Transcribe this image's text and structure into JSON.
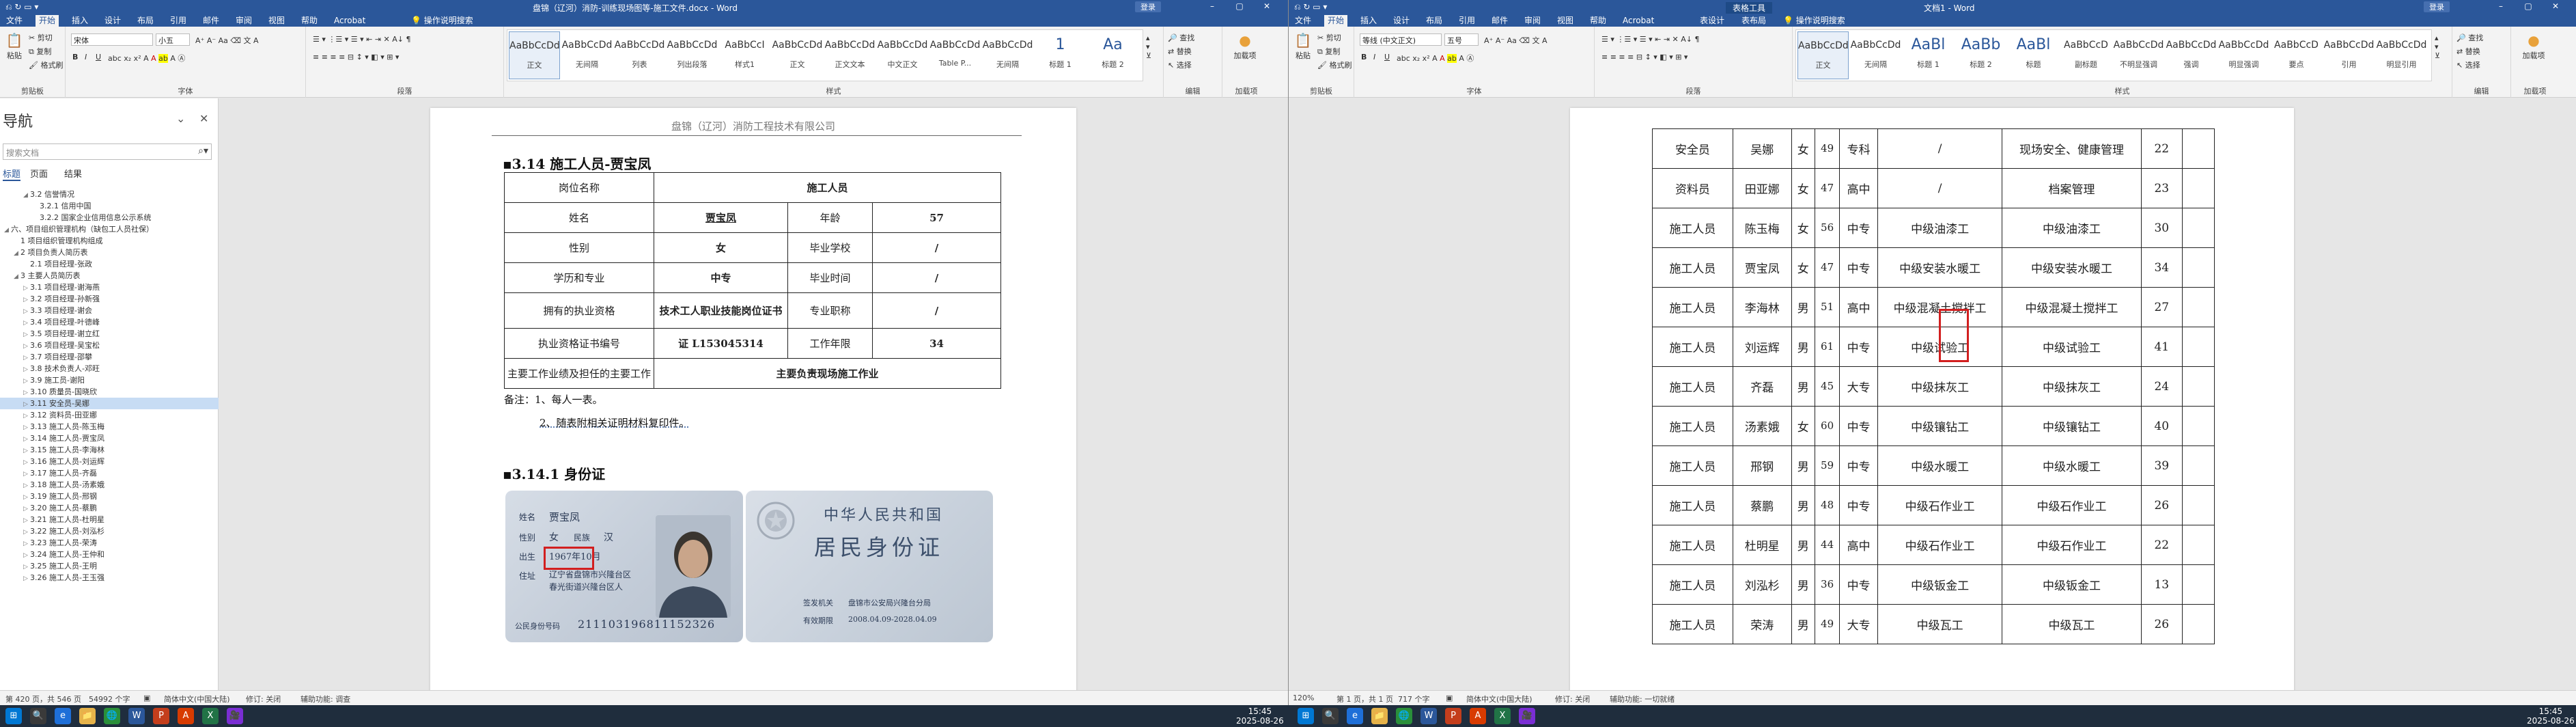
{
  "left": {
    "title": "盘锦（辽河）消防-训练现场图等-施工文件.docx - Word",
    "qat": "⎌ ↻ ▭ ▾",
    "share": "共享",
    "tabs": [
      "文件",
      "开始",
      "插入",
      "设计",
      "布局",
      "引用",
      "邮件",
      "审阅",
      "视图",
      "帮助",
      "Acrobat",
      "操作说明搜索"
    ],
    "ribbon": {
      "clipboard": {
        "label": "剪贴板",
        "paste": "粘贴",
        "cut": "剪切",
        "copy": "复制",
        "painter": "格式刷"
      },
      "font": {
        "label": "字体",
        "name": "宋体",
        "size": "小五",
        "bold": "B",
        "italic": "I",
        "underline": "U"
      },
      "paragraph": {
        "label": "段落"
      },
      "styles": {
        "label": "样式",
        "items": [
          {
            "preview": "AaBbCcDd",
            "name": "正文"
          },
          {
            "preview": "AaBbCcDd",
            "name": "无间隔"
          },
          {
            "preview": "AaBbCcDd",
            "name": "列表"
          },
          {
            "preview": "AaBbCcDd",
            "name": "列出段落"
          },
          {
            "preview": "AaBbCcI",
            "name": "样式1"
          },
          {
            "preview": "AaBbCcDd",
            "name": "正文"
          },
          {
            "preview": "AaBbCcDd",
            "name": "正文文本"
          },
          {
            "preview": "AaBbCcDd",
            "name": "中文正文"
          },
          {
            "preview": "AaBbCcDd",
            "name": "Table P..."
          },
          {
            "preview": "AaBbCcDd",
            "name": "无间隔"
          },
          {
            "preview": "1",
            "name": "标题 1"
          },
          {
            "preview": "Aa",
            "name": "标题 2"
          }
        ]
      },
      "editing": {
        "label": "编辑",
        "find": "查找",
        "replace": "替换",
        "select": "选择"
      },
      "addin": {
        "label": "加载项",
        "btn": "加载项"
      }
    },
    "nav": {
      "title": "导航",
      "search": "搜索文档",
      "tabs": [
        "标题",
        "页面",
        "结果"
      ],
      "items": [
        {
          "t": "3.2 信誉情况",
          "l": 2,
          "ar": "◢"
        },
        {
          "t": "3.2.1 信用中国",
          "l": 3,
          "ar": ""
        },
        {
          "t": "3.2.2 国家企业信用信息公示系统",
          "l": 3,
          "ar": ""
        },
        {
          "t": "六、项目组织管理机构（缺包工人员社保）",
          "l": 0,
          "ar": "◢"
        },
        {
          "t": "1 项目组织管理机构组成",
          "l": 1,
          "ar": ""
        },
        {
          "t": "2 项目负责人简历表",
          "l": 1,
          "ar": "◢"
        },
        {
          "t": "2.1 项目经理-张政",
          "l": 2,
          "ar": ""
        },
        {
          "t": "3 主要人员简历表",
          "l": 1,
          "ar": "◢"
        },
        {
          "t": "3.1 项目经理-谢海燕",
          "l": 2,
          "ar": "▷"
        },
        {
          "t": "3.2 项目经理-孙新强",
          "l": 2,
          "ar": "▷"
        },
        {
          "t": "3.3 项目经理-谢会",
          "l": 2,
          "ar": "▷"
        },
        {
          "t": "3.4 项目经理-叶德峰",
          "l": 2,
          "ar": "▷"
        },
        {
          "t": "3.5 项目经理-谢立红",
          "l": 2,
          "ar": "▷"
        },
        {
          "t": "3.6 项目经理-吴宝松",
          "l": 2,
          "ar": "▷"
        },
        {
          "t": "3.7 项目经理-邵攀",
          "l": 2,
          "ar": "▷"
        },
        {
          "t": "3.8 技术负责人-邓旺",
          "l": 2,
          "ar": "▷"
        },
        {
          "t": "3.9 施工员-谢阳",
          "l": 2,
          "ar": "▷"
        },
        {
          "t": "3.10 质量员-国晓欣",
          "l": 2,
          "ar": "▷"
        },
        {
          "t": "3.11 安全员-吴娜",
          "l": 2,
          "ar": "▷",
          "sel": true
        },
        {
          "t": "3.12 资料员-田亚娜",
          "l": 2,
          "ar": "▷"
        },
        {
          "t": "3.13 施工人员-陈玉梅",
          "l": 2,
          "ar": "▷"
        },
        {
          "t": "3.14 施工人员-贾宝凤",
          "l": 2,
          "ar": "▷"
        },
        {
          "t": "3.15 施工人员-李海林",
          "l": 2,
          "ar": "▷"
        },
        {
          "t": "3.16 施工人员-刘运辉",
          "l": 2,
          "ar": "▷"
        },
        {
          "t": "3.17 施工人员-齐磊",
          "l": 2,
          "ar": "▷"
        },
        {
          "t": "3.18 施工人员-汤素娥",
          "l": 2,
          "ar": "▷"
        },
        {
          "t": "3.19 施工人员-邢钢",
          "l": 2,
          "ar": "▷"
        },
        {
          "t": "3.20 施工人员-蔡鹏",
          "l": 2,
          "ar": "▷"
        },
        {
          "t": "3.21 施工人员-杜明星",
          "l": 2,
          "ar": "▷"
        },
        {
          "t": "3.22 施工人员-刘泓杉",
          "l": 2,
          "ar": "▷"
        },
        {
          "t": "3.23 施工人员-荣涛",
          "l": 2,
          "ar": "▷"
        },
        {
          "t": "3.24 施工人员-王仲和",
          "l": 2,
          "ar": "▷"
        },
        {
          "t": "3.25 施工人员-王明",
          "l": 2,
          "ar": "▷"
        },
        {
          "t": "3.26 施工人员-王玉强",
          "l": 2,
          "ar": "▷"
        }
      ]
    },
    "doc": {
      "header": "盘锦（辽河）消防工程技术有限公司",
      "h1": "3.14 施工人员-贾宝凤",
      "rows": [
        [
          {
            "t": "岗位名称"
          },
          {
            "t": "施工人员",
            "b": true,
            "cs": 3
          }
        ],
        [
          {
            "t": "姓名"
          },
          {
            "t": "贾宝凤",
            "b": true,
            "u": true
          },
          {
            "t": "年龄"
          },
          {
            "t": "57",
            "b": true
          }
        ],
        [
          {
            "t": "性别"
          },
          {
            "t": "女",
            "b": true
          },
          {
            "t": "毕业学校"
          },
          {
            "t": "/",
            "b": true
          }
        ],
        [
          {
            "t": "学历和专业"
          },
          {
            "t": "中专",
            "b": true
          },
          {
            "t": "毕业时间"
          },
          {
            "t": "/",
            "b": true
          }
        ],
        [
          {
            "t": "拥有的执业资格"
          },
          {
            "t": "技术工人职业技能岗位证书",
            "b": true,
            "wrap": true
          },
          {
            "t": "专业职称"
          },
          {
            "t": "/",
            "b": true
          }
        ],
        [
          {
            "t": "执业资格证书编号"
          },
          {
            "t": "证 L153045314",
            "b": true
          },
          {
            "t": "工作年限"
          },
          {
            "t": "34",
            "b": true
          }
        ],
        [
          {
            "t": "主要工作业绩及担任的主要工作"
          },
          {
            "t": "主要负责现场施工作业",
            "b": true,
            "cs": 3
          }
        ]
      ],
      "note1": "备注：1、每人一表。",
      "note2": "2、随表附相关证明材料复印件。",
      "h2": "3.14.1 身份证",
      "card_front": {
        "name_label": "姓名",
        "name": "贾宝凤",
        "sex_label": "性别",
        "sex": "女",
        "nation_label": "民族",
        "nation": "汉",
        "birth_label": "出生",
        "birth": "1967年10月",
        "addr_label": "住址",
        "addr1": "辽宁省盘锦市兴隆台区",
        "addr2": "春光街道兴隆台区人",
        "id_label": "公民身份号码",
        "id": "211103196811152326"
      },
      "card_back": {
        "t1": "中华人民共和国",
        "t2": "居民身份证",
        "auth_label": "签发机关",
        "auth": "盘锦市公安局兴隆台分局",
        "valid_label": "有效期限",
        "valid": "2008.04.09-2028.04.09"
      }
    },
    "status": {
      "page": "第 420 页，共 546 页",
      "words": "54992 个字",
      "lang": "简体中文(中国大陆)",
      "track": "修订: 关闭",
      "access": "辅助功能: 调查"
    }
  },
  "right": {
    "title": "文档1 - Word",
    "context_tab": "表格工具",
    "qat": "⎌ ↻ ▭ ▾",
    "share": "共享",
    "tabs": [
      "文件",
      "开始",
      "插入",
      "设计",
      "布局",
      "引用",
      "邮件",
      "审阅",
      "视图",
      "帮助",
      "Acrobat",
      "表设计",
      "表布局",
      "操作说明搜索"
    ],
    "ribbon": {
      "clipboard": {
        "label": "剪贴板",
        "paste": "粘贴",
        "cut": "剪切",
        "copy": "复制",
        "painter": "格式刷"
      },
      "font": {
        "label": "字体",
        "name": "等线 (中文正文)",
        "size": "五号",
        "bold": "B",
        "italic": "I",
        "underline": "U"
      },
      "paragraph": {
        "label": "段落"
      },
      "styles": {
        "label": "样式",
        "items": [
          {
            "preview": "AaBbCcDd",
            "name": "正文"
          },
          {
            "preview": "AaBbCcDd",
            "name": "无间隔"
          },
          {
            "preview": "AaBl",
            "name": "标题 1"
          },
          {
            "preview": "AaBb",
            "name": "标题 2"
          },
          {
            "preview": "AaBl",
            "name": "标题"
          },
          {
            "preview": "AaBbCcD",
            "name": "副标题"
          },
          {
            "preview": "AaBbCcDd",
            "name": "不明显强调"
          },
          {
            "preview": "AaBbCcDd",
            "name": "强调"
          },
          {
            "preview": "AaBbCcDd",
            "name": "明显强调"
          },
          {
            "preview": "AaBbCcD",
            "name": "要点"
          },
          {
            "preview": "AaBbCcDd",
            "name": "引用"
          },
          {
            "preview": "AaBbCcDd",
            "name": "明显引用"
          }
        ]
      },
      "editing": {
        "label": "编辑",
        "find": "查找",
        "replace": "替换",
        "select": "选择"
      },
      "addin": {
        "label": "加载项",
        "btn": "加载项"
      }
    },
    "table": [
      [
        "安全员",
        "吴娜",
        "女",
        "49",
        "专科",
        "/",
        "现场安全、健康管理",
        "22"
      ],
      [
        "资料员",
        "田亚娜",
        "女",
        "47",
        "高中",
        "/",
        "档案管理",
        "23"
      ],
      [
        "施工人员",
        "陈玉梅",
        "女",
        "56",
        "中专",
        "中级油漆工",
        "中级油漆工",
        "30"
      ],
      [
        "施工人员",
        "贾宝凤",
        "女",
        "47",
        "中专",
        "中级安装水暖工",
        "中级安装水暖工",
        "34"
      ],
      [
        "施工人员",
        "李海林",
        "男",
        "51",
        "高中",
        "中级混凝土搅拌工",
        "中级混凝土搅拌工",
        "27"
      ],
      [
        "施工人员",
        "刘运辉",
        "男",
        "61",
        "中专",
        "中级试验工",
        "中级试验工",
        "41"
      ],
      [
        "施工人员",
        "齐磊",
        "男",
        "45",
        "大专",
        "中级抹灰工",
        "中级抹灰工",
        "24"
      ],
      [
        "施工人员",
        "汤素娥",
        "女",
        "60",
        "中专",
        "中级镶钻工",
        "中级镶钻工",
        "40"
      ],
      [
        "施工人员",
        "邢钢",
        "男",
        "59",
        "中专",
        "中级水暖工",
        "中级水暖工",
        "39"
      ],
      [
        "施工人员",
        "蔡鹏",
        "男",
        "48",
        "中专",
        "中级石作业工",
        "中级石作业工",
        "26"
      ],
      [
        "施工人员",
        "杜明星",
        "男",
        "44",
        "高中",
        "中级石作业工",
        "中级石作业工",
        "22"
      ],
      [
        "施工人员",
        "刘泓杉",
        "男",
        "36",
        "中专",
        "中级钣金工",
        "中级钣金工",
        "13"
      ],
      [
        "施工人员",
        "荣涛",
        "男",
        "49",
        "大专",
        "中级瓦工",
        "中级瓦工",
        "26"
      ]
    ],
    "status": {
      "zoom": "120%",
      "page": "第 1 页，共 1 页",
      "words": "717 个字",
      "lang": "简体中文(中国大陆)",
      "track": "修订: 关闭",
      "access": "辅助功能: 一切就绪"
    }
  },
  "taskbar": {
    "time_l": "15:45",
    "date_l": "2025-08-26",
    "time_r": "15:45",
    "date_r": "2025-08-26",
    "apps": [
      "⊞",
      "🔍",
      "e",
      "📁",
      "🌐",
      "W",
      "P",
      "A",
      "X",
      "🎥"
    ]
  },
  "colors": {
    "word_blue": "#2b579a",
    "highlight": "#c7dcf4",
    "red_box": "#d21f1f",
    "taskbar": "#1f2d3d"
  }
}
